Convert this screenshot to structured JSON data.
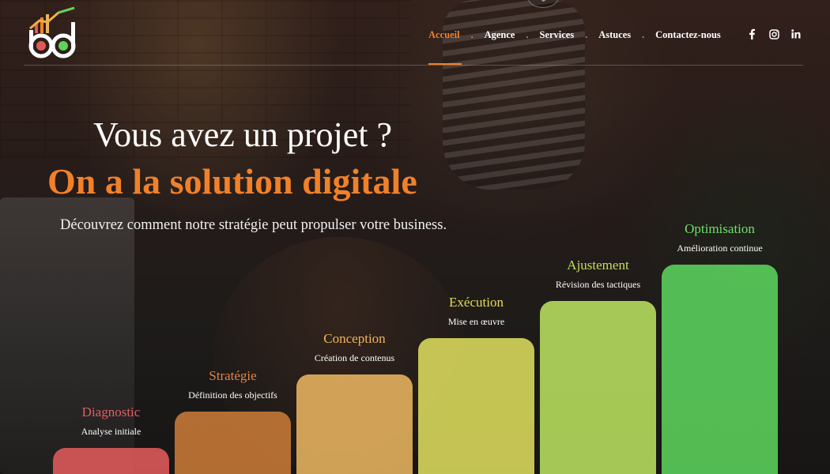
{
  "nav": {
    "items": [
      {
        "label": "Accueil",
        "active": true
      },
      {
        "label": "Agence",
        "active": false
      },
      {
        "label": "Services",
        "active": false
      },
      {
        "label": "Astuces",
        "active": false
      },
      {
        "label": "Contactez-nous",
        "active": false
      }
    ],
    "separator": "."
  },
  "social": [
    "facebook-icon",
    "instagram-icon",
    "linkedin-icon"
  ],
  "hero": {
    "title_line1": "Vous avez un projet ?",
    "title_line2": "On a la solution digitale",
    "subtitle": "Découvrez comment notre stratégie peut propulser votre business."
  },
  "steps": [
    {
      "name": "Diagnostic",
      "desc": "Analyse initiale",
      "color": "#e06060",
      "bar_color": "#e05a5a",
      "level": 1
    },
    {
      "name": "Stratégie",
      "desc": "Définition des objectifs",
      "color": "#e0874a",
      "bar_color": "#c87a38",
      "level": 2
    },
    {
      "name": "Conception",
      "desc": "Création de contenus",
      "color": "#f0b45a",
      "bar_color": "#e8b460",
      "level": 3
    },
    {
      "name": "Exécution",
      "desc": "Mise en œuvre",
      "color": "#e5dc56",
      "bar_color": "#dcdc5c",
      "level": 4
    },
    {
      "name": "Ajustement",
      "desc": "Révision des tactiques",
      "color": "#bde05a",
      "bar_color": "#b8e05e",
      "level": 5
    },
    {
      "name": "Optimisation",
      "desc": "Amélioration continue",
      "color": "#6ee06a",
      "bar_color": "#5cd35c",
      "level": 6
    }
  ],
  "colors": {
    "accent": "#f0812a",
    "nav_text": "#ffffff"
  }
}
